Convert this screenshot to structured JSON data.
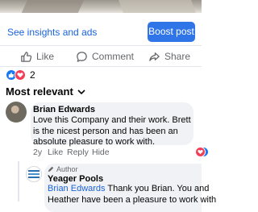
{
  "post": {
    "insights_link": "See insights and ads",
    "boost_button": "Boost post"
  },
  "actions": {
    "like": "Like",
    "comment": "Comment",
    "share": "Share"
  },
  "reactions": {
    "count": "2",
    "types": [
      "like",
      "love"
    ]
  },
  "comments_filter": "Most relevant",
  "comments": [
    {
      "author": "Brian Edwards",
      "text": "Love this Company and their work.  Brett is the nicest person and has been an absolute pleasure to work with.",
      "time": "2y",
      "like": "Like",
      "reply": "Reply",
      "hide": "Hide",
      "reaction_count": "2"
    }
  ],
  "reply": {
    "badge": "Author",
    "author": "Yeager Pools",
    "mention": "Brian Edwards",
    "text_line1_rest": " Thank you Brian. You and",
    "text_line2": "Heather have been a pleasure to work with"
  },
  "colors": {
    "link_blue": "#1a62d9",
    "boost_blue": "#2f75e8",
    "like_blue": "#1877f2",
    "love_red": "#f33e58",
    "bubble_gray": "#f0f2f5",
    "secondary_text": "#65676b"
  }
}
